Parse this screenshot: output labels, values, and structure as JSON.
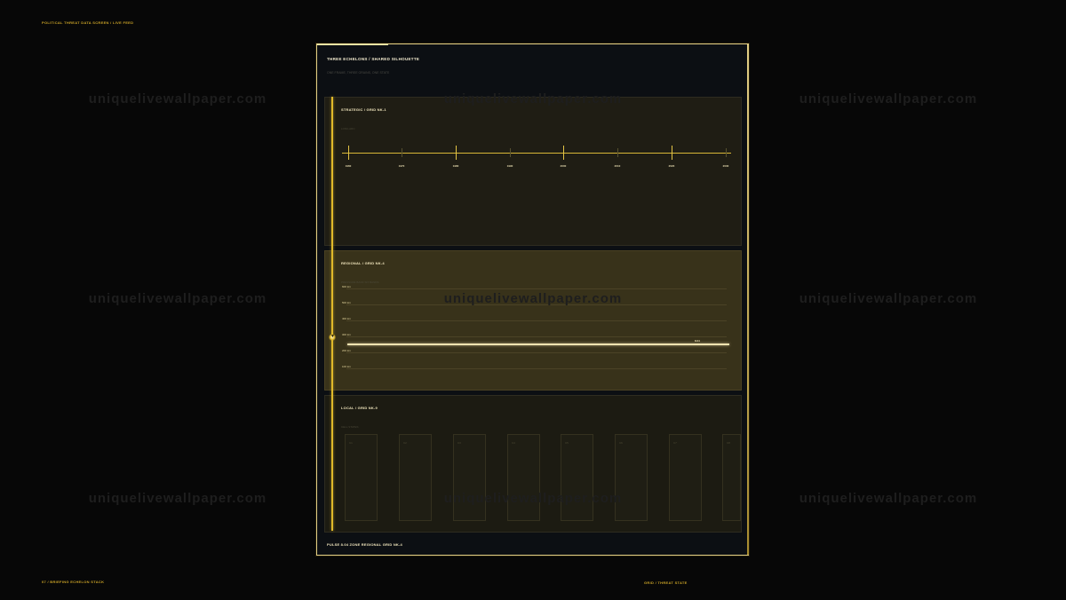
{
  "screen": {
    "top_label": "POLITICAL THREAT DATA SCREEN  /  LIVE FEED",
    "bottom_left_label": "07 / BRIEFING ECHELON STACK",
    "bottom_right_label": "GRID   /   THREAT STATE",
    "watermark": "uniquelivewallpaper.com"
  },
  "frame": {
    "title": "THREE ECHELONS  /  SHARED SILHOUETTE",
    "subtitle": "ONE FRAME, THREE GRAINS, ONE STATE",
    "footer": "PULSE 8.04   ZONE REGIONAL   GRID NK-4"
  },
  "panels": {
    "strategic": {
      "title": "STRATEGIC  /  GRID NK-1",
      "subtitle": "LONG ARC",
      "ticks": [
        "1960",
        "1970",
        "1980",
        "1990",
        "2000",
        "2010",
        "2020",
        "2030"
      ]
    },
    "regional": {
      "title": "REGIONAL  /  GRID NK-4",
      "subtitle": "PRESSURE BAND  SIX BANDS",
      "y_labels": [
        "600 km",
        "500 km",
        "400 km",
        "300 km",
        "200 km",
        "100 km"
      ],
      "end_label": "8.04"
    },
    "local": {
      "title": "LOCAL  /  GRID NK-9",
      "subtitle": "CELL STATES",
      "cards": [
        "C1",
        "C2",
        "C3",
        "C4",
        "C5",
        "C6",
        "C7",
        "C8"
      ]
    }
  },
  "colors": {
    "accent": "#e0b92a",
    "frame": "#e3cf86",
    "background": "#070707"
  }
}
